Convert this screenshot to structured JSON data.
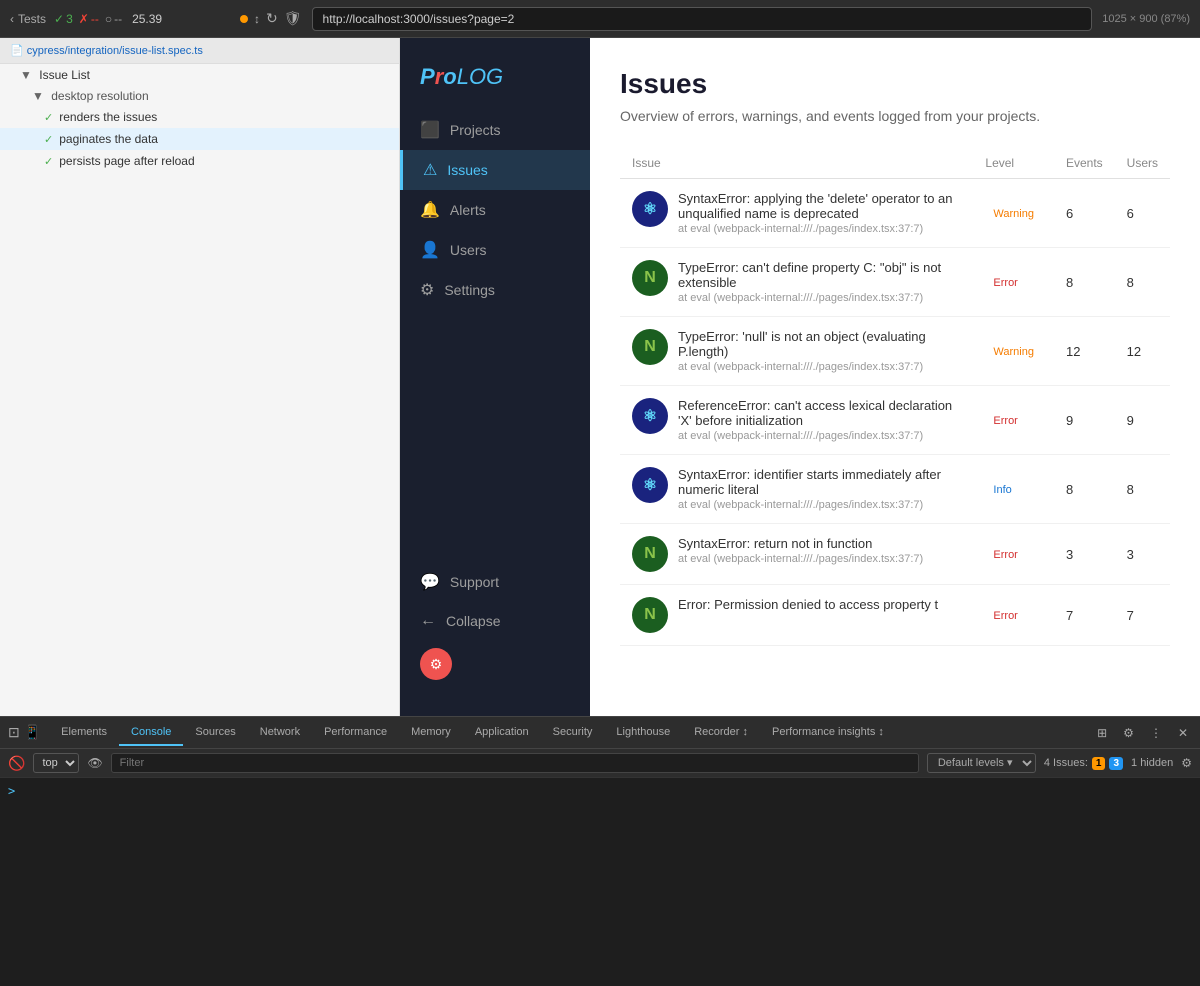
{
  "browser": {
    "tests_label": "Tests",
    "pass_count": "3",
    "fail_count": "--",
    "pending_count": "--",
    "time": "25.39",
    "dot_indicator": "●",
    "url": "http://localhost:3000/issues?page=2",
    "resolution": "1025 × 900 (87%)"
  },
  "cypress": {
    "file": "cypress/integration/issue-list.spec.ts",
    "suite": "Issue List",
    "sub_suite": "desktop resolution",
    "tests": [
      {
        "label": "renders the issues",
        "status": "pass"
      },
      {
        "label": "paginates the data",
        "status": "pass",
        "active": true
      },
      {
        "label": "persists page after reload",
        "status": "pass"
      }
    ]
  },
  "prolog": {
    "logo_pro": "Pro",
    "logo_log": "LOG",
    "nav": [
      {
        "icon": "⬛",
        "label": "Projects",
        "active": false
      },
      {
        "icon": "⚠",
        "label": "Issues",
        "active": true
      },
      {
        "icon": "🔔",
        "label": "Alerts",
        "active": false
      },
      {
        "icon": "👤",
        "label": "Users",
        "active": false
      },
      {
        "icon": "⚙",
        "label": "Settings",
        "active": false
      }
    ],
    "nav_bottom": [
      {
        "icon": "💬",
        "label": "Support",
        "active": false
      },
      {
        "icon": "←",
        "label": "Collapse",
        "active": false
      }
    ],
    "page_title": "Issues",
    "page_subtitle": "Overview of errors, warnings, and events logged from your projects.",
    "table": {
      "columns": [
        "Issue",
        "Level",
        "Events",
        "Users"
      ],
      "rows": [
        {
          "icon_type": "react",
          "icon_letter": "⚛",
          "name": "SyntaxError: applying the 'delete' operator to an unqualified name is deprecated",
          "location": "at eval (webpack-internal:///./pages/index.tsx:37:7)",
          "level": "Warning",
          "level_class": "warning",
          "events": "6",
          "users": "6"
        },
        {
          "icon_type": "node",
          "icon_letter": "N",
          "name": "TypeError: can't define property C: \"obj\" is not extensible",
          "location": "at eval (webpack-internal:///./pages/index.tsx:37:7)",
          "level": "Error",
          "level_class": "error",
          "events": "8",
          "users": "8"
        },
        {
          "icon_type": "node",
          "icon_letter": "N",
          "name": "TypeError: 'null' is not an object (evaluating P.length)",
          "location": "at eval (webpack-internal:///./pages/index.tsx:37:7)",
          "level": "Warning",
          "level_class": "warning",
          "events": "12",
          "users": "12"
        },
        {
          "icon_type": "react",
          "icon_letter": "⚛",
          "name": "ReferenceError: can't access lexical declaration 'X' before initialization",
          "location": "at eval (webpack-internal:///./pages/index.tsx:37:7)",
          "level": "Error",
          "level_class": "error",
          "events": "9",
          "users": "9"
        },
        {
          "icon_type": "react",
          "icon_letter": "⚛",
          "name": "SyntaxError: identifier starts immediately after numeric literal",
          "location": "at eval (webpack-internal:///./pages/index.tsx:37:7)",
          "level": "Info",
          "level_class": "info",
          "events": "8",
          "users": "8"
        },
        {
          "icon_type": "node",
          "icon_letter": "N",
          "name": "SyntaxError: return not in function",
          "location": "at eval (webpack-internal:///./pages/index.tsx:37:7)",
          "level": "Error",
          "level_class": "error",
          "events": "3",
          "users": "3"
        },
        {
          "icon_type": "node",
          "icon_letter": "N",
          "name": "Error: Permission denied to access property t",
          "location": "",
          "level": "Error",
          "level_class": "error",
          "events": "7",
          "users": "7"
        }
      ]
    }
  },
  "devtools": {
    "tabs": [
      "Elements",
      "Console",
      "Sources",
      "Network",
      "Performance",
      "Memory",
      "Application",
      "Security",
      "Lighthouse",
      "Recorder ↕",
      "Performance insights ↕"
    ],
    "active_tab": "Console",
    "icon_buttons": [
      "⊞",
      "⚙",
      "⋮",
      "✕"
    ],
    "toolbar": {
      "context_label": "top",
      "eye_label": "👁",
      "filter_placeholder": "Filter",
      "levels_label": "Default levels ▾"
    },
    "status": {
      "issues_label": "4 Issues:",
      "badge_orange": "1",
      "badge_blue": "3",
      "hidden_label": "1 hidden",
      "settings_icon": "⚙"
    }
  }
}
